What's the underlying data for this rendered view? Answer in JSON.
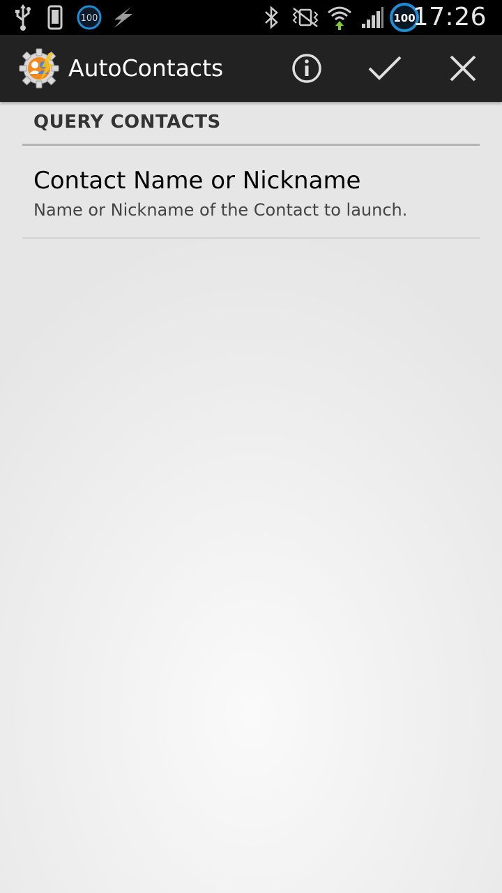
{
  "status_bar": {
    "time": "17:26",
    "battery_level_left": "100",
    "battery_level_right": "100",
    "icons_left": [
      "usb-icon",
      "phone-icon",
      "battery-badge-icon",
      "lightning-icon"
    ],
    "icons_right": [
      "bluetooth-icon",
      "vibrate-off-icon",
      "wifi-icon",
      "signal-icon",
      "battery-icon"
    ]
  },
  "action_bar": {
    "title": "AutoContacts",
    "icon": "autocontacts-gear-icon",
    "actions": [
      "info-icon",
      "check-icon",
      "close-icon"
    ]
  },
  "section": {
    "header": "QUERY CONTACTS"
  },
  "preference": {
    "title": "Contact Name or Nickname",
    "summary": "Name or Nickname of the Contact to launch."
  },
  "colors": {
    "status_bar": "#000000",
    "action_bar": "#222222",
    "accent_blue": "#1e8fd6",
    "app_icon_orange": "#f08a1c"
  }
}
